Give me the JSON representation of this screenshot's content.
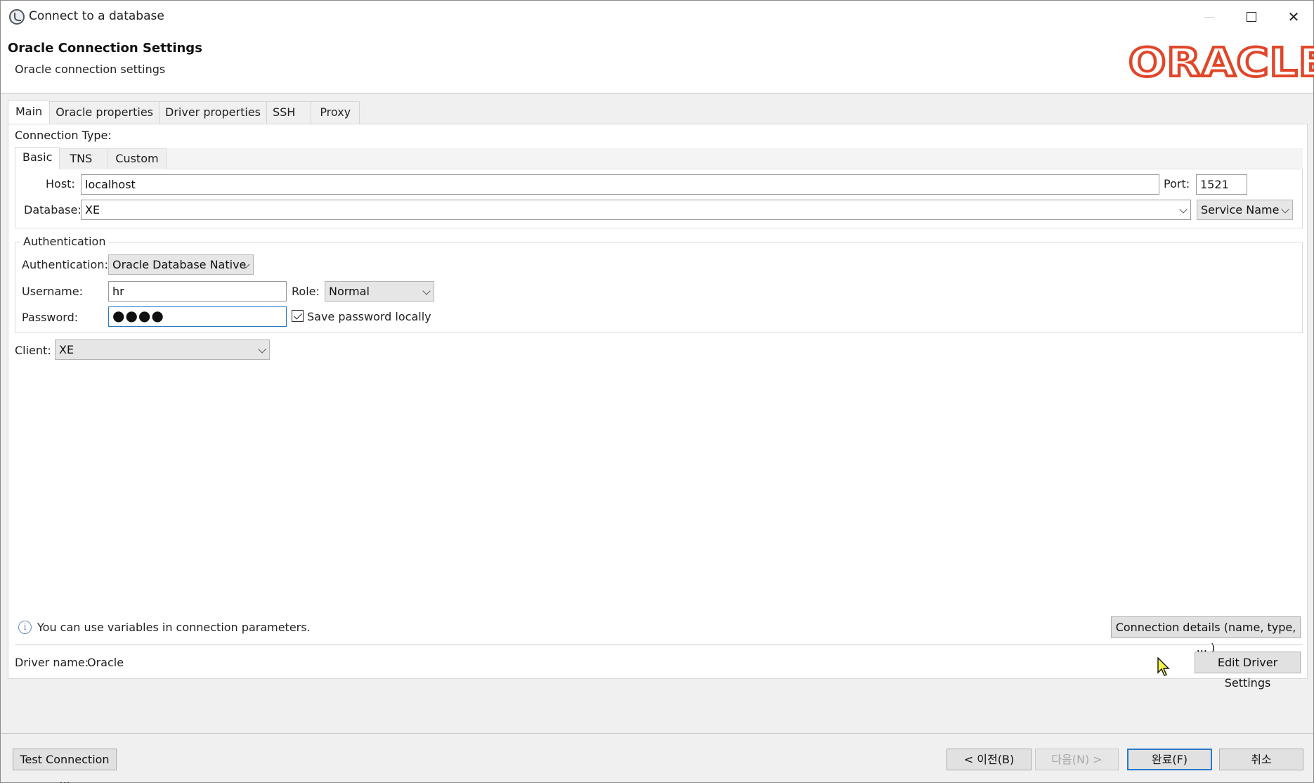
{
  "window": {
    "title": "Connect to a database"
  },
  "header": {
    "title": "Oracle Connection Settings",
    "subtitle": "Oracle connection settings",
    "logo_text": "ORACLE",
    "logo_color": "#e0472a"
  },
  "tabs": [
    {
      "label": "Main",
      "active": true
    },
    {
      "label": "Oracle properties"
    },
    {
      "label": "Driver properties"
    },
    {
      "label": "SSH"
    },
    {
      "label": "Proxy"
    }
  ],
  "connection": {
    "type_label": "Connection Type:",
    "type_tabs": [
      {
        "label": "Basic",
        "active": true
      },
      {
        "label": "TNS"
      },
      {
        "label": "Custom"
      }
    ],
    "host_label": "Host:",
    "host_value": "localhost",
    "port_label": "Port:",
    "port_value": "1521",
    "database_label": "Database:",
    "database_value": "XE",
    "service_option": "Service Name"
  },
  "auth": {
    "group_label": "Authentication",
    "auth_label": "Authentication:",
    "auth_value": "Oracle Database Native",
    "username_label": "Username:",
    "username_value": "hr",
    "role_label": "Role:",
    "role_value": "Normal",
    "password_label": "Password:",
    "password_value": "●●●●",
    "save_password_label": "Save password locally",
    "save_password_checked": true
  },
  "client": {
    "label": "Client:",
    "value": "XE"
  },
  "info": {
    "text": "You can use variables in connection parameters.",
    "details_button": "Connection details (name, type, ... )"
  },
  "driver": {
    "label": "Driver name:",
    "value": "Oracle",
    "edit_button": "Edit Driver Settings"
  },
  "footer": {
    "test_button": "Test Connection ...",
    "back_button": "< 이전(B)",
    "next_button": "다음(N) >",
    "finish_button": "완료(F)",
    "cancel_button": "취소"
  },
  "accent_color": "#2a78c8"
}
